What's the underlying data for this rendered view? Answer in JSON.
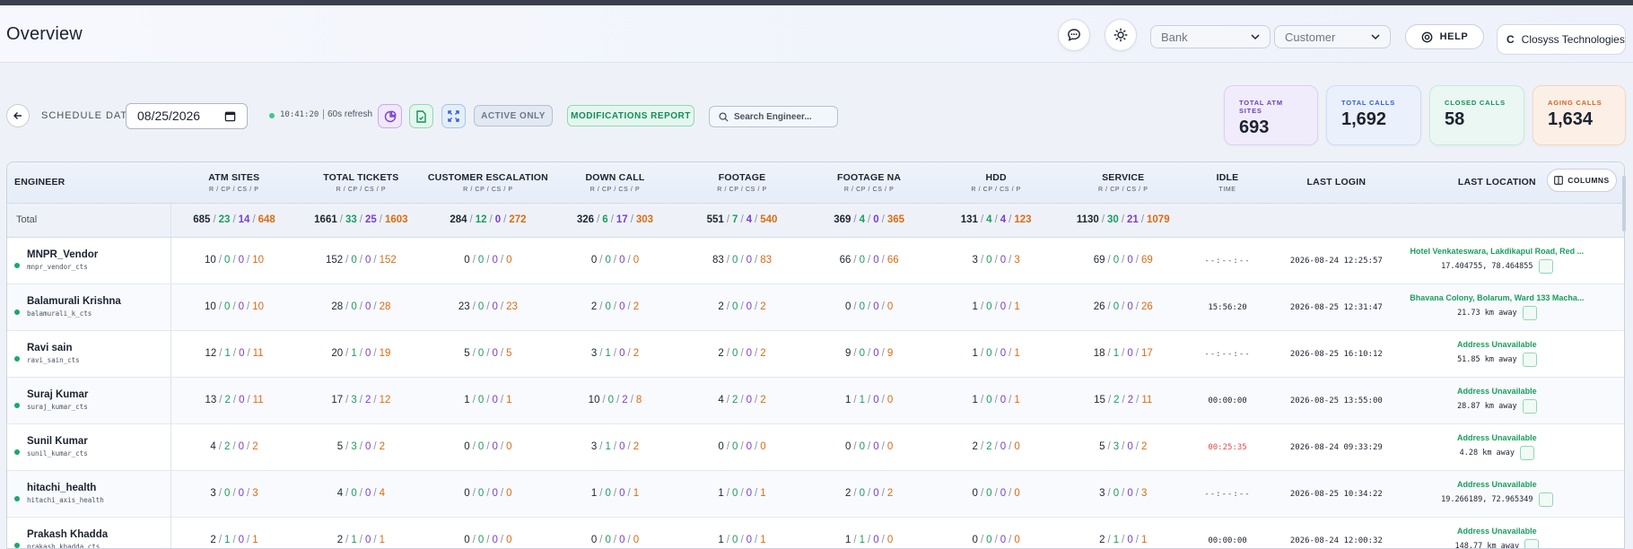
{
  "header": {
    "title": "Overview",
    "bank_placeholder": "Bank",
    "customer_placeholder": "Customer",
    "help_label": "HELP",
    "company_initial": "C",
    "company_name": "Closyss Technologies"
  },
  "toolbar": {
    "schedule_label": "SCHEDULE DATE",
    "date_value": "08/25/2026",
    "clock": "10:41:20",
    "refresh": "60s refresh",
    "active_only_label": "ACTIVE ONLY",
    "modifications_label": "MODIFICATIONS REPORT",
    "search_placeholder": "Search Engineer..."
  },
  "cards": [
    {
      "label": "TOTAL ATM SITES",
      "value": "693",
      "color": "#6b3fb8"
    },
    {
      "label": "TOTAL CALLS",
      "value": "1,692",
      "color": "#2f5bd0"
    },
    {
      "label": "CLOSED CALLS",
      "value": "58",
      "color": "#138d5c"
    },
    {
      "label": "AGING CALLS",
      "value": "1,634",
      "color": "#d0611c"
    }
  ],
  "table": {
    "columns_button": "COLUMNS",
    "headers": {
      "engineer": "ENGINEER",
      "atm": "ATM SITES",
      "tickets": "TOTAL TICKETS",
      "escalation": "CUSTOMER ESCALATION",
      "down": "DOWN CALL",
      "footage": "FOOTAGE",
      "footage_na": "FOOTAGE NA",
      "hdd": "HDD",
      "service": "SERVICE",
      "idle": "IDLE",
      "last_login": "LAST LOGIN",
      "last_location": "LAST LOCATION",
      "rcpsp": "R / CP / CS / P",
      "time": "TIME"
    },
    "total": {
      "label": "Total",
      "atm": [
        "685",
        "23",
        "14",
        "648"
      ],
      "tickets": [
        "1661",
        "33",
        "25",
        "1603"
      ],
      "escalation": [
        "284",
        "12",
        "0",
        "272"
      ],
      "down": [
        "326",
        "6",
        "17",
        "303"
      ],
      "footage": [
        "551",
        "7",
        "4",
        "540"
      ],
      "footage_na": [
        "369",
        "4",
        "0",
        "365"
      ],
      "hdd": [
        "131",
        "4",
        "4",
        "123"
      ],
      "service": [
        "1130",
        "30",
        "21",
        "1079"
      ]
    },
    "rows": [
      {
        "name": "MNPR_Vendor",
        "user": "mnpr_vendor_cts",
        "atm": [
          "10",
          "0",
          "0",
          "10"
        ],
        "tickets": [
          "152",
          "0",
          "0",
          "152"
        ],
        "escalation": [
          "0",
          "0",
          "0",
          "0"
        ],
        "down": [
          "0",
          "0",
          "0",
          "0"
        ],
        "footage": [
          "83",
          "0",
          "0",
          "83"
        ],
        "footage_na": [
          "66",
          "0",
          "0",
          "66"
        ],
        "hdd": [
          "3",
          "0",
          "0",
          "3"
        ],
        "service": [
          "69",
          "0",
          "0",
          "69"
        ],
        "idle": "--:--:--",
        "login": "2026-08-24 12:25:57",
        "loc": "Hotel Venkateswara, Lakdikapul Road, Red ...",
        "loc_sub": "17.404755, 78.464855"
      },
      {
        "name": "Balamurali Krishna",
        "user": "balamurali_k_cts",
        "atm": [
          "10",
          "0",
          "0",
          "10"
        ],
        "tickets": [
          "28",
          "0",
          "0",
          "28"
        ],
        "escalation": [
          "23",
          "0",
          "0",
          "23"
        ],
        "down": [
          "2",
          "0",
          "0",
          "2"
        ],
        "footage": [
          "2",
          "0",
          "0",
          "2"
        ],
        "footage_na": [
          "0",
          "0",
          "0",
          "0"
        ],
        "hdd": [
          "1",
          "0",
          "0",
          "1"
        ],
        "service": [
          "26",
          "0",
          "0",
          "26"
        ],
        "idle": "15:56:20",
        "login": "2026-08-25 12:31:47",
        "loc": "Bhavana Colony, Bolarum, Ward 133 Macha...",
        "loc_sub": "21.73 km away"
      },
      {
        "name": "Ravi sain",
        "user": "ravi_sain_cts",
        "atm": [
          "12",
          "1",
          "0",
          "11"
        ],
        "tickets": [
          "20",
          "1",
          "0",
          "19"
        ],
        "escalation": [
          "5",
          "0",
          "0",
          "5"
        ],
        "down": [
          "3",
          "1",
          "0",
          "2"
        ],
        "footage": [
          "2",
          "0",
          "0",
          "2"
        ],
        "footage_na": [
          "9",
          "0",
          "0",
          "9"
        ],
        "hdd": [
          "1",
          "0",
          "0",
          "1"
        ],
        "service": [
          "18",
          "1",
          "0",
          "17"
        ],
        "idle": "--:--:--",
        "login": "2026-08-25 16:10:12",
        "loc": "Address Unavailable",
        "loc_sub": "51.85 km away"
      },
      {
        "name": "Suraj Kumar",
        "user": "suraj_kumar_cts",
        "atm": [
          "13",
          "2",
          "0",
          "11"
        ],
        "tickets": [
          "17",
          "3",
          "2",
          "12"
        ],
        "escalation": [
          "1",
          "0",
          "0",
          "1"
        ],
        "down": [
          "10",
          "0",
          "2",
          "8"
        ],
        "footage": [
          "4",
          "2",
          "0",
          "2"
        ],
        "footage_na": [
          "1",
          "1",
          "0",
          "0"
        ],
        "hdd": [
          "1",
          "0",
          "0",
          "1"
        ],
        "service": [
          "15",
          "2",
          "2",
          "11"
        ],
        "idle": "00:00:00",
        "login": "2026-08-25 13:55:00",
        "loc": "Address Unavailable",
        "loc_sub": "28.87 km away"
      },
      {
        "name": "Sunil Kumar",
        "user": "sunil_kumar_cts",
        "atm": [
          "4",
          "2",
          "0",
          "2"
        ],
        "tickets": [
          "5",
          "3",
          "0",
          "2"
        ],
        "escalation": [
          "0",
          "0",
          "0",
          "0"
        ],
        "down": [
          "3",
          "1",
          "0",
          "2"
        ],
        "footage": [
          "0",
          "0",
          "0",
          "0"
        ],
        "footage_na": [
          "0",
          "0",
          "0",
          "0"
        ],
        "hdd": [
          "2",
          "2",
          "0",
          "0"
        ],
        "service": [
          "5",
          "3",
          "0",
          "2"
        ],
        "idle": "00:25:35",
        "login": "2026-08-24 09:33:29",
        "loc": "Address Unavailable",
        "loc_sub": "4.28 km away"
      },
      {
        "name": "hitachi_health",
        "user": "hitachi_axis_health",
        "atm": [
          "3",
          "0",
          "0",
          "3"
        ],
        "tickets": [
          "4",
          "0",
          "0",
          "4"
        ],
        "escalation": [
          "0",
          "0",
          "0",
          "0"
        ],
        "down": [
          "1",
          "0",
          "0",
          "1"
        ],
        "footage": [
          "1",
          "0",
          "0",
          "1"
        ],
        "footage_na": [
          "2",
          "0",
          "0",
          "2"
        ],
        "hdd": [
          "0",
          "0",
          "0",
          "0"
        ],
        "service": [
          "3",
          "0",
          "0",
          "3"
        ],
        "idle": "--:--:--",
        "login": "2026-08-25 10:34:22",
        "loc": "Address Unavailable",
        "loc_sub": "19.266189, 72.965349"
      },
      {
        "name": "Prakash Khadda",
        "user": "prakash_khadda_cts",
        "atm": [
          "2",
          "1",
          "0",
          "1"
        ],
        "tickets": [
          "2",
          "1",
          "0",
          "1"
        ],
        "escalation": [
          "0",
          "0",
          "0",
          "0"
        ],
        "down": [
          "0",
          "0",
          "0",
          "0"
        ],
        "footage": [
          "1",
          "0",
          "0",
          "1"
        ],
        "footage_na": [
          "1",
          "1",
          "0",
          "0"
        ],
        "hdd": [
          "0",
          "0",
          "0",
          "0"
        ],
        "service": [
          "2",
          "1",
          "0",
          "1"
        ],
        "idle": "00:00:00",
        "login": "2026-08-24 12:00:32",
        "loc": "Address Unavailable",
        "loc_sub": "148.77 km away"
      }
    ]
  }
}
